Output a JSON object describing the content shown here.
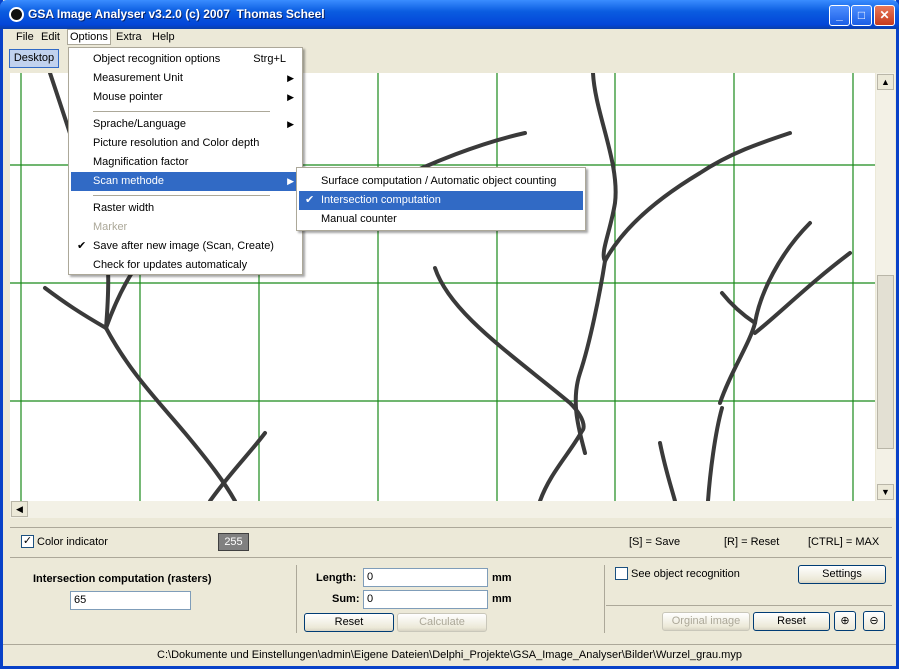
{
  "window": {
    "title": "GSA Image Analyser v3.2.0 (c) 2007  Thomas Scheel"
  },
  "menubar": {
    "file": "File",
    "edit": "Edit",
    "options": "Options",
    "extra": "Extra",
    "help": "Help"
  },
  "toolbar": {
    "desktop": "Desktop"
  },
  "options_menu": {
    "object_recognition": "Object recognition options",
    "object_recognition_shortcut": "Strg+L",
    "measurement_unit": "Measurement Unit",
    "mouse_pointer": "Mouse pointer",
    "language": "Sprache/Language",
    "picture_resolution": "Picture resolution and Color depth",
    "magnification": "Magnification factor",
    "scan_method": "Scan methode",
    "raster_width": "Raster width",
    "marker": "Marker",
    "save_after": "Save after new image (Scan, Create)",
    "check_updates": "Check for updates automaticaly"
  },
  "scan_submenu": {
    "surface": "Surface computation / Automatic object counting",
    "intersection": "Intersection computation",
    "manual": "Manual counter"
  },
  "bottom": {
    "color_indicator": "Color indicator",
    "color_value": "255",
    "hint_save": "[S] = Save",
    "hint_reset": "[R] = Reset",
    "hint_max": "[CTRL] = MAX",
    "mode_label": "Intersection computation (rasters)",
    "mode_value": "65",
    "length_label": "Length:",
    "length_value": "0",
    "length_unit": "mm",
    "sum_label": "Sum:",
    "sum_value": "0",
    "sum_unit": "mm",
    "reset": "Reset",
    "calculate": "Calculate",
    "see_object": "See object recognition",
    "settings": "Settings",
    "original_image": "Orginal image",
    "reset2": "Reset"
  },
  "status": {
    "path": "C:\\Dokumente und Einstellungen\\admin\\Eigene Dateien\\Delphi_Projekte\\GSA_Image_Analyser\\Bilder\\Wurzel_grau.myp"
  },
  "colors": {
    "grid": "#1a8a1a",
    "highlight": "#316ac5",
    "title_blue": "#0a5ce0"
  }
}
